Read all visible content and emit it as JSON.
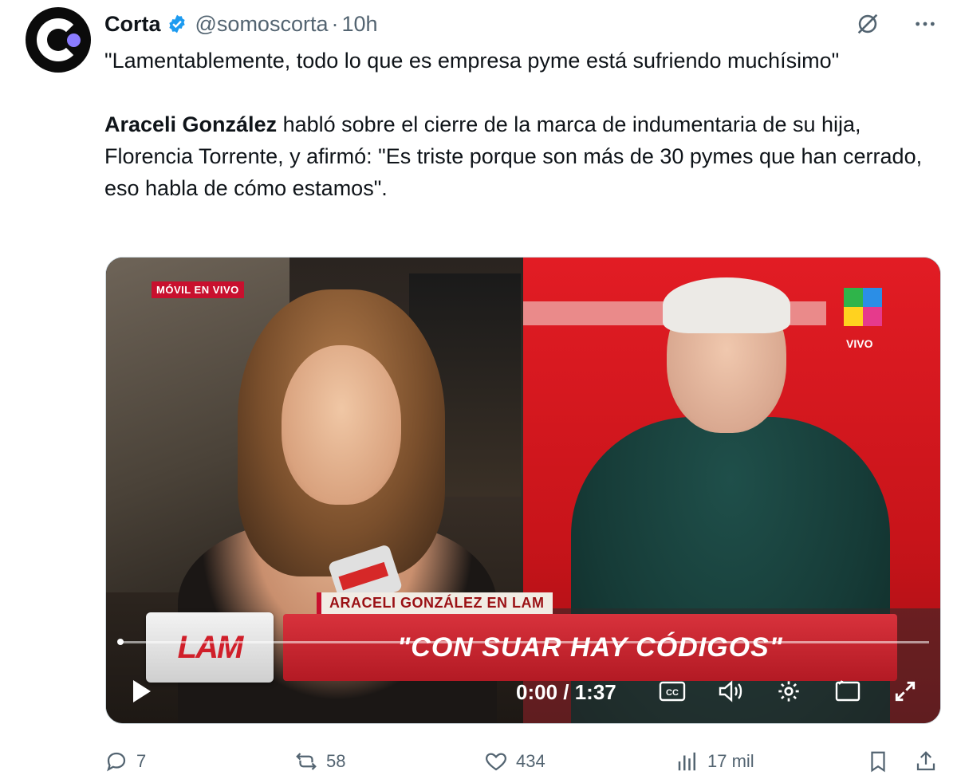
{
  "tweet": {
    "display_name": "Corta",
    "handle": "@somoscorta",
    "separator": "·",
    "time": "10h",
    "line1": "\"Lamentablemente, todo lo que es empresa pyme está sufriendo muchísimo\"",
    "bold_name": "Araceli González",
    "line2_rest": " habló sobre el cierre de la marca de indumentaria de su hija, Florencia Torrente, y afirmó: \"Es triste porque son más de 30 pymes que han cerrado, eso habla de cómo estamos\"."
  },
  "media": {
    "live_tag": "MÓVIL EN VIVO",
    "channel_label": "VIVO",
    "name_tag": "ARACELI GONZÁLEZ EN LAM",
    "lam_logo": "LAM",
    "headline": "\"CON SUAR HAY CÓDIGOS\"",
    "time": "0:00 / 1:37",
    "progress": 0.0
  },
  "actions": {
    "replies": "7",
    "reposts": "58",
    "likes": "434",
    "views": "17 mil"
  },
  "colors": {
    "accent_blue": "#1d9bf0",
    "muted": "#536471",
    "headline_red": "#b31a24"
  }
}
